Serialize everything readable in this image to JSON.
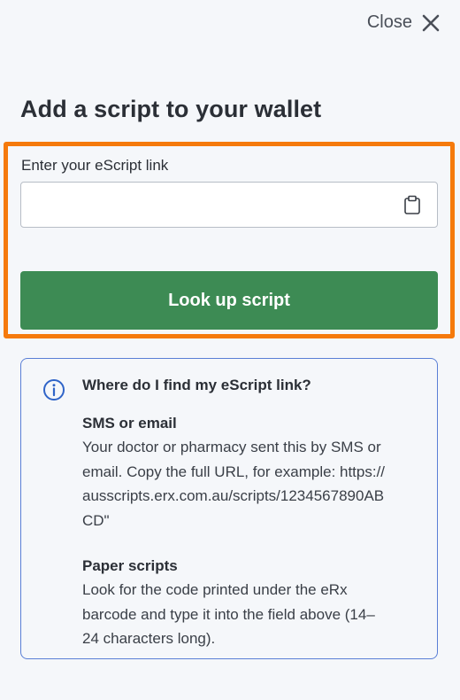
{
  "header": {
    "close_label": "Close",
    "close_icon": "x-icon"
  },
  "page": {
    "title": "Add a script to your wallet"
  },
  "form": {
    "field_label": "Enter your eScript link",
    "input_value": "",
    "input_placeholder": "",
    "paste_icon": "clipboard-icon",
    "submit_label": "Look up script",
    "submit_color": "#3d8b54",
    "highlight_color": "#f57a0c"
  },
  "help": {
    "icon": "info-icon",
    "heading": "Where do I find my eScript link?",
    "sections": [
      {
        "title": "SMS or email",
        "lines": [
          "Your doctor or pharmacy sent this by SMS or",
          "email. Copy the full URL, for example: https://",
          "ausscripts.erx.com.au/scripts/1234567890AB",
          "CD\""
        ]
      },
      {
        "title": "Paper scripts",
        "lines": [
          "Look for the code printed under the eRx",
          "barcode and type it into the field above (14–",
          "24 characters long)."
        ]
      }
    ],
    "border_color": "#5a7fd6"
  }
}
